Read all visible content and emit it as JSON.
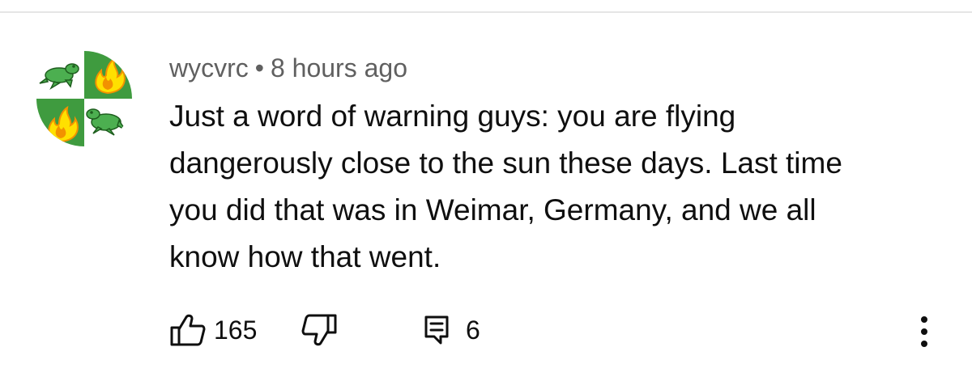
{
  "comment": {
    "author": "wycvrc",
    "separator": "•",
    "timestamp": "8 hours ago",
    "text_lines": [
      "Just a word of warning guys: you are flying",
      "dangerously close to the sun these days. Last time",
      "you did that was in Weimar, Germany, and we all",
      "know how that went."
    ]
  },
  "actions": {
    "like_count": "165",
    "reply_count": "6",
    "like_icon": "thumbs-up-icon",
    "dislike_icon": "thumbs-down-icon",
    "reply_icon": "reply-icon",
    "more_icon": "more-vertical-icon"
  },
  "avatar": {
    "description_icon": "frog-fire-quartered-shield-icon",
    "colors": {
      "green": "#3f9b3f",
      "white": "#ffffff",
      "frog_green": "#4caf50",
      "flame_yellow": "#ffe000",
      "flame_orange": "#f29200"
    }
  }
}
